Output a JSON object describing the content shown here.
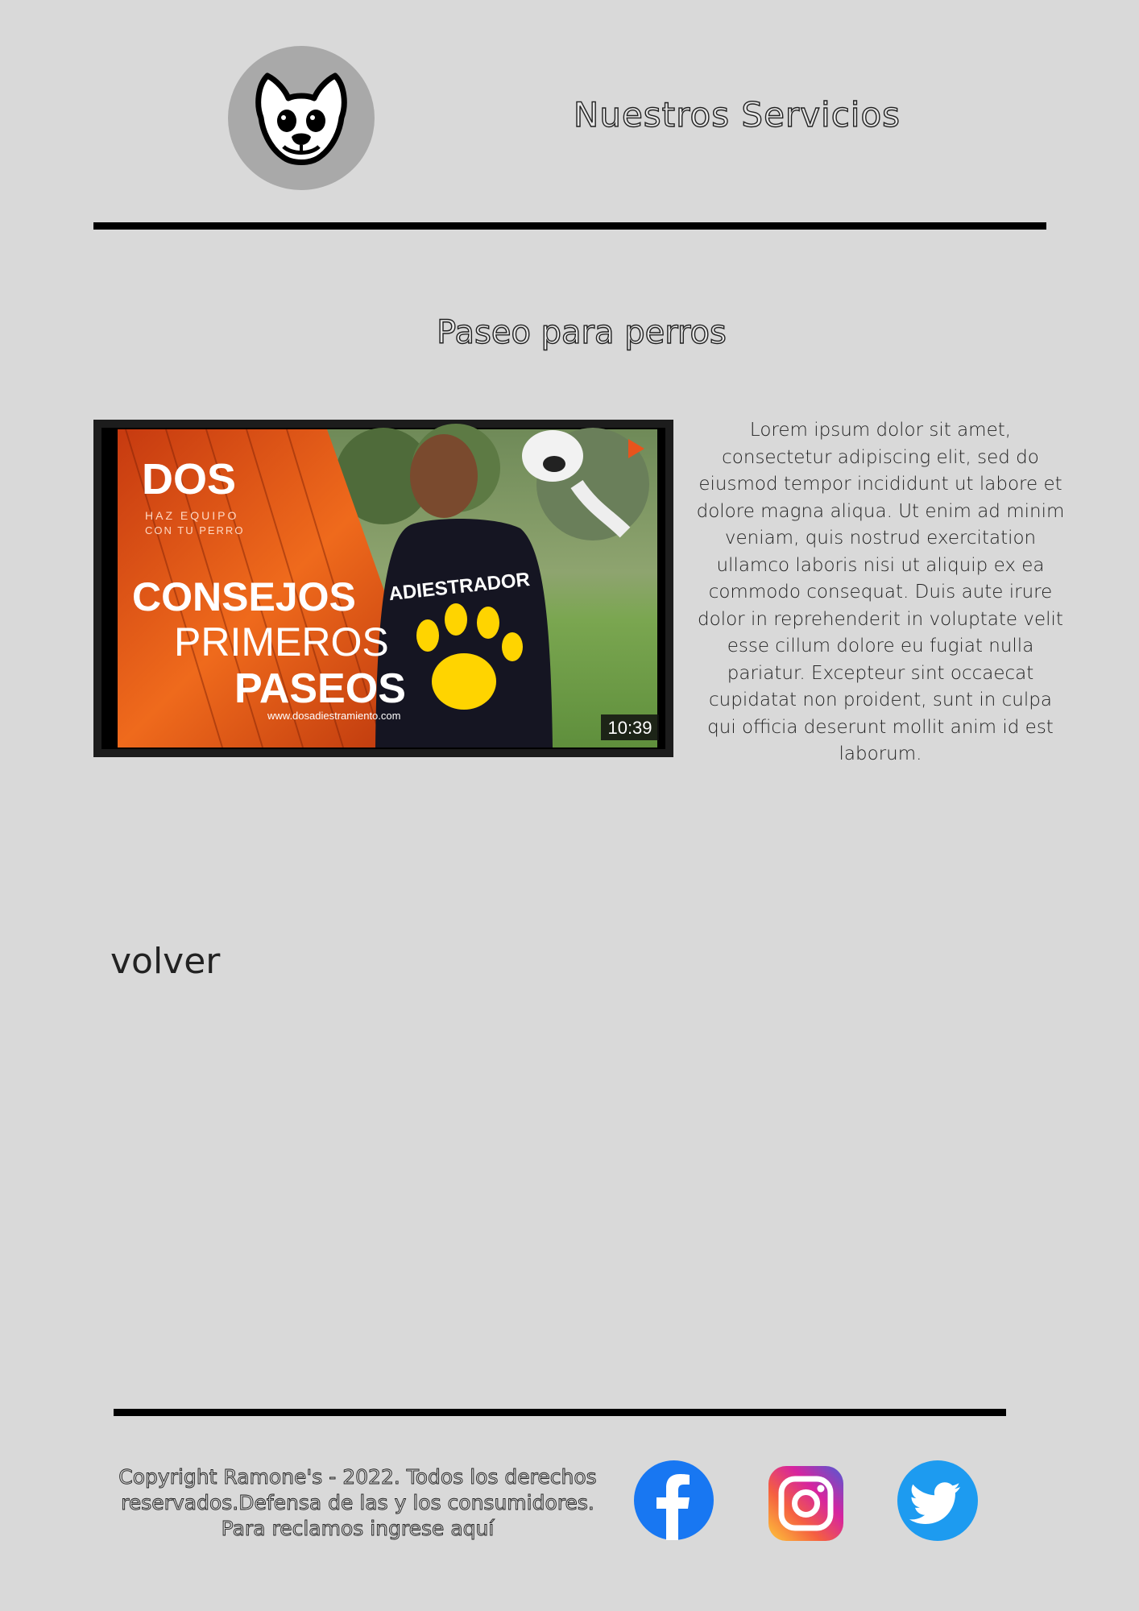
{
  "header": {
    "logo_icon": "french-bulldog-icon",
    "title": "Nuestros Servicios"
  },
  "section": {
    "title": "Paseo para perros",
    "video": {
      "brand": "DOS",
      "brand_sub_1": "HAZ EQUIPO",
      "brand_sub_2": "CON TU PERRO",
      "line1": "CONSEJOS",
      "line2": "PRIMEROS",
      "line3": "PASEOS",
      "website": "www.dosadiestramiento.com",
      "shirt_text": "ADIESTRADOR",
      "duration": "10:39",
      "play_icon": "play-icon"
    },
    "description": "Lorem ipsum dolor sit amet, consectetur adipiscing elit, sed do eiusmod tempor incididunt ut labore et dolore magna aliqua. Ut enim ad minim veniam, quis nostrud exercitation ullamco laboris nisi ut aliquip ex ea commodo consequat. Duis aute irure dolor in reprehenderit in voluptate velit esse cillum dolore eu fugiat nulla pariatur. Excepteur sint occaecat cupidatat non proident, sunt in culpa qui officia deserunt mollit anim id est laborum."
  },
  "nav": {
    "back_label": "volver"
  },
  "footer": {
    "copyright": "Copyright Ramone's - 2022. Todos los derechos reservados.Defensa de las y los consumidores. Para reclamos ingrese aquí",
    "social": [
      {
        "icon": "facebook-icon",
        "color": "#1877f2"
      },
      {
        "icon": "instagram-icon",
        "color": "#d6249f"
      },
      {
        "icon": "twitter-icon",
        "color": "#1d9bf0"
      }
    ]
  }
}
